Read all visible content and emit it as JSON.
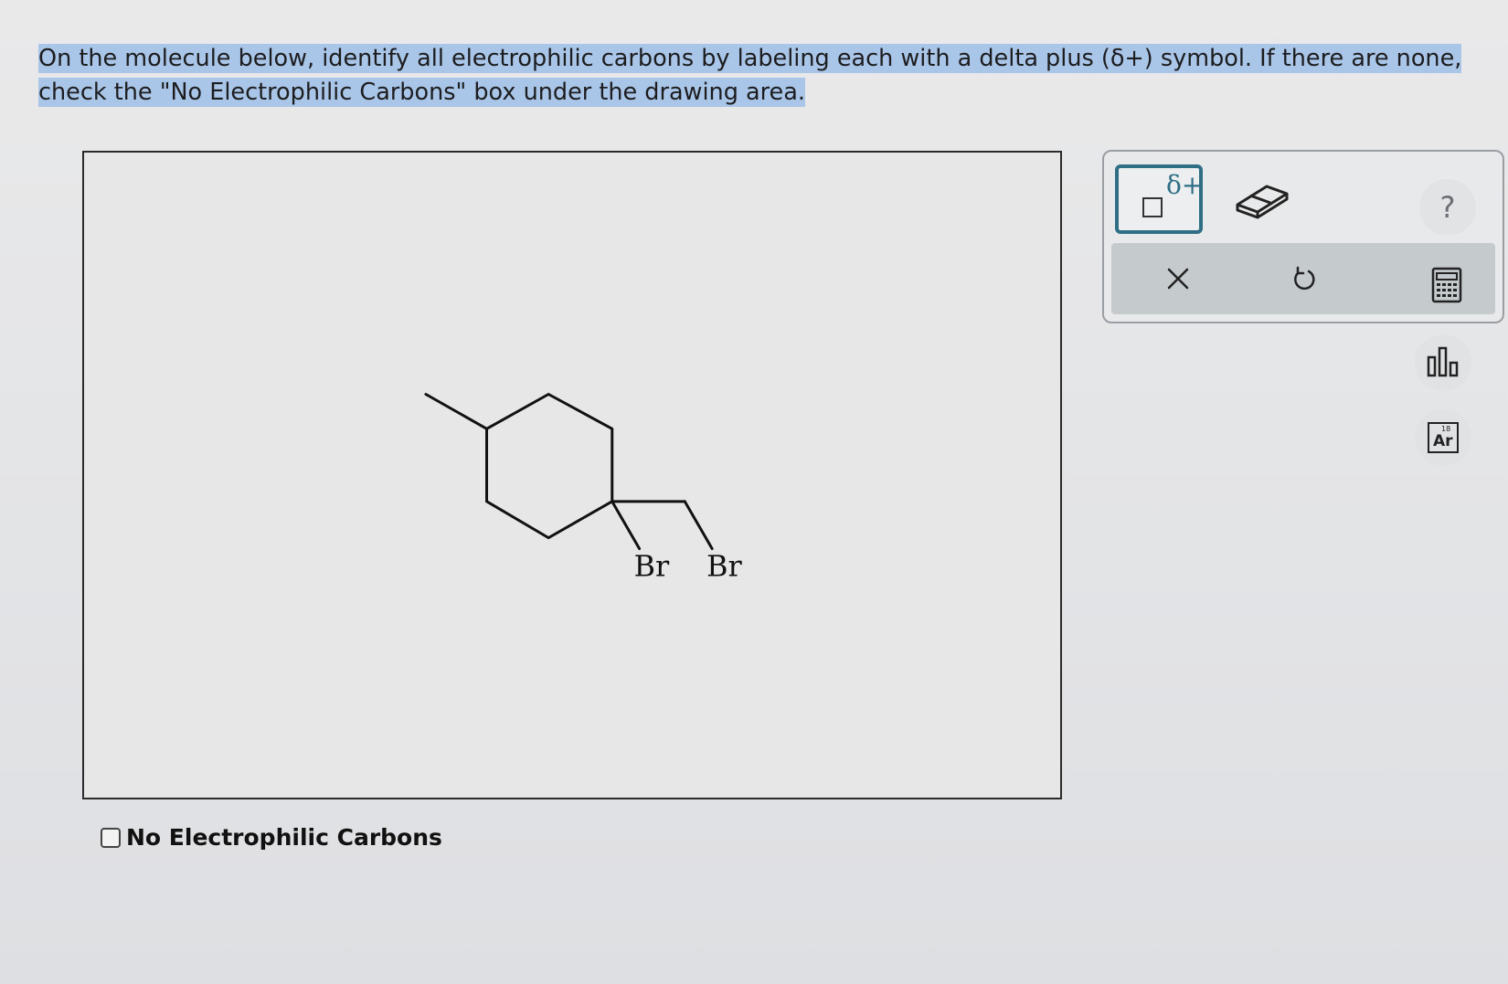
{
  "instructions": {
    "text": "On the molecule below, identify all electrophilic carbons by labeling each with a delta plus (δ+) symbol. If there are none, check the \"No Electrophilic Carbons\" box under the drawing area."
  },
  "molecule": {
    "atom_labels": [
      "Br",
      "Br"
    ]
  },
  "checkbox": {
    "label": "No Electrophilic Carbons",
    "checked": false
  },
  "toolbar": {
    "delta_tool_label": "δ+",
    "help_label": "?",
    "eraser_icon": "eraser-icon",
    "clear_icon": "close-icon",
    "undo_icon": "undo-icon",
    "accent_color": "#2e6f86"
  },
  "side_tools": {
    "calculator_icon": "calculator-icon",
    "chart_icon": "bar-chart-icon",
    "periodic_table_label": "Ar",
    "periodic_table_number": "18"
  }
}
